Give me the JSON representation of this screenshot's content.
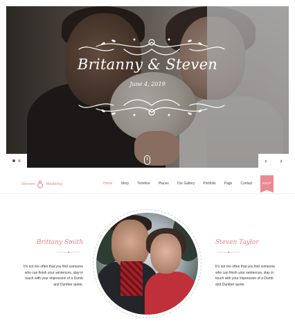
{
  "hero": {
    "title": "Britanny & Steven",
    "date": "June 4, 2019",
    "prev_arrow": "‹",
    "next_arrow": "›"
  },
  "nav": {
    "logo_left": "Steven",
    "logo_right": "Wedding",
    "items": [
      {
        "label": "Home",
        "active": true
      },
      {
        "label": "Story",
        "active": false
      },
      {
        "label": "Timeline",
        "active": false
      },
      {
        "label": "Places",
        "active": false
      },
      {
        "label": "Our Gallery",
        "active": false
      },
      {
        "label": "Portfolio",
        "active": false
      },
      {
        "label": "Page",
        "active": false
      },
      {
        "label": "Contact",
        "active": false
      }
    ],
    "bookmark": "RSVP"
  },
  "couple": {
    "bride": {
      "name": "Brittany Smith",
      "bio": "It's not too often that you find someone who can finish your sentences, stay in touch with your impression of a Dumb and Dumber quote."
    },
    "groom": {
      "name": "Steven Taylor",
      "bio": "It's not too often that you find someone who can finish your sentences, stay in touch with your impression of a Dumb and Dumber quote."
    }
  },
  "colors": {
    "accent": "#e07f86",
    "accent_dark": "#ea8a90",
    "text": "#333333"
  }
}
